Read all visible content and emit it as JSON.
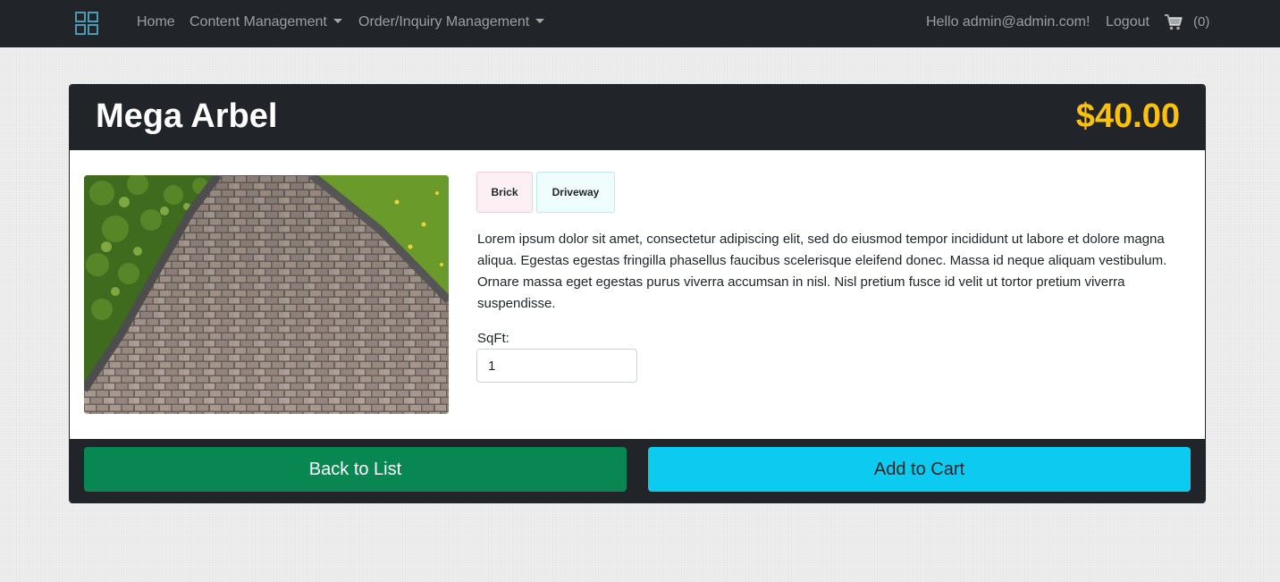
{
  "nav": {
    "brand_icon": "grid-logo-icon",
    "home": "Home",
    "content_management": "Content Management",
    "order_inquiry_management": "Order/Inquiry Management",
    "greeting": "Hello admin@admin.com!",
    "logout": "Logout",
    "cart_icon": "shopping-cart-icon",
    "cart_count": "(0)"
  },
  "product": {
    "name": "Mega Arbel",
    "price": "$40.00",
    "image_icon": "brick-paver-walkway-photo",
    "tags": [
      "Brick",
      "Driveway"
    ],
    "description": "Lorem ipsum dolor sit amet, consectetur adipiscing elit, sed do eiusmod tempor incididunt ut labore et dolore magna aliqua. Egestas egestas fringilla phasellus faucibus scelerisque eleifend donec. Massa id neque aliquam vestibulum. Ornare massa eget egestas purus viverra accumsan in nisl. Nisl pretium fusce id velit ut tortor pretium viverra suspendisse.",
    "sqft_label": "SqFt:",
    "sqft_value": "1"
  },
  "actions": {
    "back": "Back to List",
    "add_to_cart": "Add to Cart"
  },
  "colors": {
    "navbar": "#212529",
    "price": "#ffc107",
    "back_button": "#088752",
    "cart_button": "#0dcaf0"
  }
}
